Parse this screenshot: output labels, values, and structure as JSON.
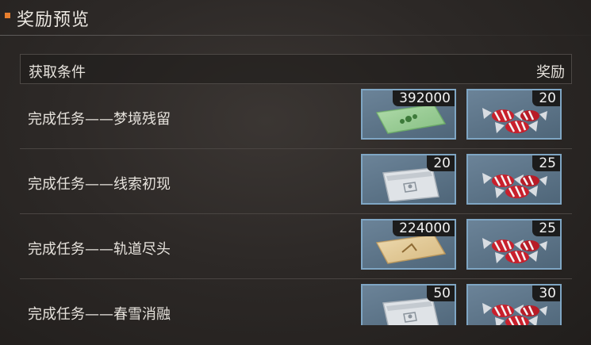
{
  "panel": {
    "title": "奖励预览"
  },
  "table": {
    "header": {
      "condition_label": "获取条件",
      "reward_label": "奖励"
    },
    "rows": [
      {
        "condition": "完成任务——梦境残留",
        "rewards": [
          {
            "icon": "green-envelope-icon",
            "count": "392000"
          },
          {
            "icon": "red-candy-icon",
            "count": "20"
          }
        ]
      },
      {
        "condition": "完成任务——线索初现",
        "rewards": [
          {
            "icon": "silver-pouch-icon",
            "count": "20"
          },
          {
            "icon": "red-candy-icon",
            "count": "25"
          }
        ]
      },
      {
        "condition": "完成任务——轨道尽头",
        "rewards": [
          {
            "icon": "gold-envelope-icon",
            "count": "224000"
          },
          {
            "icon": "red-candy-icon",
            "count": "25"
          }
        ]
      },
      {
        "condition": "完成任务——春雪消融",
        "rewards": [
          {
            "icon": "silver-pouch-icon",
            "count": "50"
          },
          {
            "icon": "red-candy-icon",
            "count": "30"
          }
        ]
      }
    ]
  },
  "colors": {
    "accent": "#e67e2e",
    "slot_border": "#7fa6c4",
    "slot_fill": "#5f7789"
  }
}
